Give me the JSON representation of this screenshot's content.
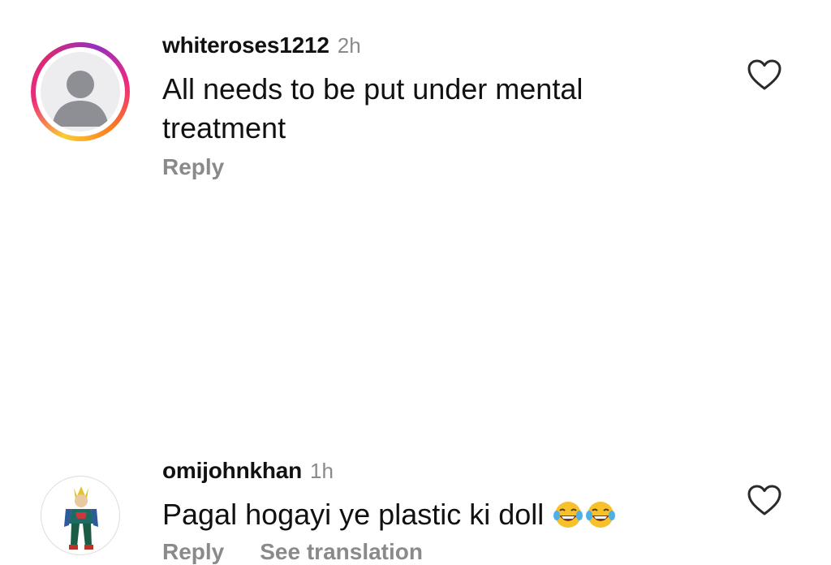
{
  "comments": [
    {
      "username": "whiteroses1212",
      "time": "2h",
      "text": "All needs to be put under mental treatment",
      "reply_label": "Reply",
      "has_story_ring": true
    },
    {
      "username": "omijohnkhan",
      "time": "1h",
      "text": "Pagal hogayi ye plastic ki doll",
      "emojis": [
        "😂",
        "😂"
      ],
      "reply_label": "Reply",
      "translate_label": "See translation",
      "has_story_ring": false
    }
  ],
  "icons": {
    "like": "heart-outline-icon",
    "default_avatar": "default-user-avatar",
    "emoji": "face-with-tears-of-joy-emoji"
  },
  "colors": {
    "text_primary": "#111111",
    "text_secondary": "#8a8a8a",
    "ring_gradient": [
      "#f9ce34",
      "#ee2a7b",
      "#962fbf",
      "#fa7e1e"
    ]
  }
}
